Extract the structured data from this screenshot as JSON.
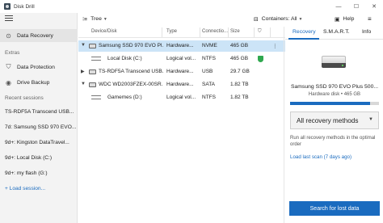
{
  "window": {
    "title": "Disk Drill",
    "min": "—",
    "max": "☐",
    "close": "✕"
  },
  "sidebar": {
    "items": [
      {
        "label": "Data Recovery"
      }
    ],
    "extras_head": "Extras",
    "extras": [
      {
        "label": "Data Protection"
      },
      {
        "label": "Drive Backup"
      }
    ],
    "recent_head": "Recent sessions",
    "sessions": [
      "TS-RDF5A Transcend USB...",
      "7d: Samsung SSD 970 EVO...",
      "9d+: Kingston DataTravel...",
      "9d+: Local Disk (C:)",
      "9d+: my flash (G:)"
    ],
    "load_session": "+ Load session..."
  },
  "toolbar": {
    "view": "Tree",
    "containers": "Containers: All",
    "help": "Help"
  },
  "table": {
    "headers": {
      "device": "Device/Disk",
      "type": "Type",
      "connection": "Connectio...",
      "size": "Size"
    },
    "rows": [
      {
        "name": "Samsung SSD 970 EVO Pl...",
        "type": "Hardware...",
        "conn": "NVME",
        "size": "465 GB",
        "selected": true
      },
      {
        "name": "Local Disk (C:)",
        "type": "Logical vol...",
        "conn": "NTFS",
        "size": "465 GB",
        "protected": true
      },
      {
        "name": "TS-RDF5A Transcend USB...",
        "type": "Hardware...",
        "conn": "USB",
        "size": "29.7 GB"
      },
      {
        "name": "WDC WD2003FZEX-00SR...",
        "type": "Hardware...",
        "conn": "SATA",
        "size": "1.82 TB"
      },
      {
        "name": "Gamemes (D:)",
        "type": "Logical vol...",
        "conn": "NTFS",
        "size": "1.82 TB"
      }
    ]
  },
  "panel": {
    "tabs": [
      "Recovery",
      "S.M.A.R.T.",
      "Info"
    ],
    "disk_name": "Samsung SSD 970 EVO Plus 500...",
    "disk_sub": "Hardware disk • 465 GB",
    "capacity_fraction": 0.9,
    "method": "All recovery methods",
    "description": "Run all recovery methods in the optimal order",
    "load_scan": "Load last scan (7 days ago)",
    "search_button": "Search for lost data"
  },
  "colors": {
    "accent": "#1a6bbf",
    "selected_row": "#cce4f7",
    "shield": "#2fa84f"
  }
}
